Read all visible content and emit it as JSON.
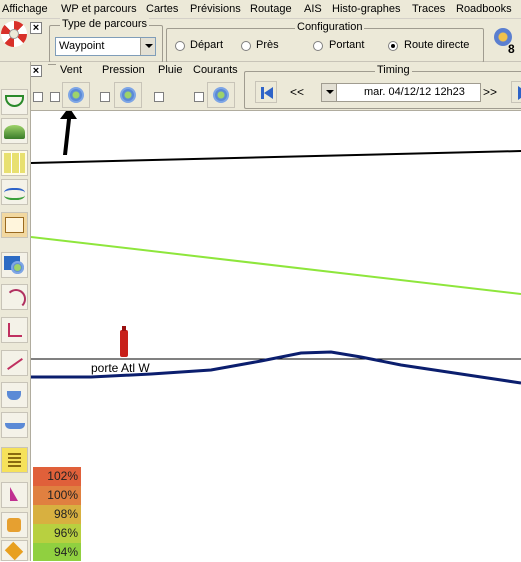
{
  "menu": [
    "Affichage",
    "WP et parcours",
    "Cartes",
    "Prévisions",
    "Routage",
    "AIS",
    "Histo-graphes",
    "Traces",
    "Roadbooks"
  ],
  "toolbar1": {
    "close_label": "×",
    "type_parcours": {
      "legend": "Type de parcours",
      "selected": "Waypoint"
    },
    "configuration": {
      "legend": "Configuration",
      "options": [
        {
          "label": "Départ",
          "selected": false
        },
        {
          "label": "Près",
          "selected": false
        },
        {
          "label": "Portant",
          "selected": false
        },
        {
          "label": "Route directe",
          "selected": true
        }
      ]
    },
    "right_badge": "8"
  },
  "toolbar2": {
    "close_label": "×",
    "layers": [
      {
        "label": "Vent"
      },
      {
        "label": "Pression"
      },
      {
        "label": "Pluie"
      },
      {
        "label": "Courants"
      }
    ],
    "timing": {
      "legend": "Timing",
      "prev_label": "<<",
      "next_label": ">>",
      "date_value": "mar. 04/12/12 12h23"
    }
  },
  "map": {
    "waypoint_label": "porte Atl W",
    "line_colors": {
      "black": "#000000",
      "green": "#8ee63c",
      "route": "#0b1e6e"
    }
  },
  "scale": [
    {
      "label": "102%",
      "color": "#e0603a"
    },
    {
      "label": "100%",
      "color": "#e08040"
    },
    {
      "label": "98%",
      "color": "#d8b040"
    },
    {
      "label": "96%",
      "color": "#b8d040"
    },
    {
      "label": "94%",
      "color": "#90d040"
    }
  ]
}
